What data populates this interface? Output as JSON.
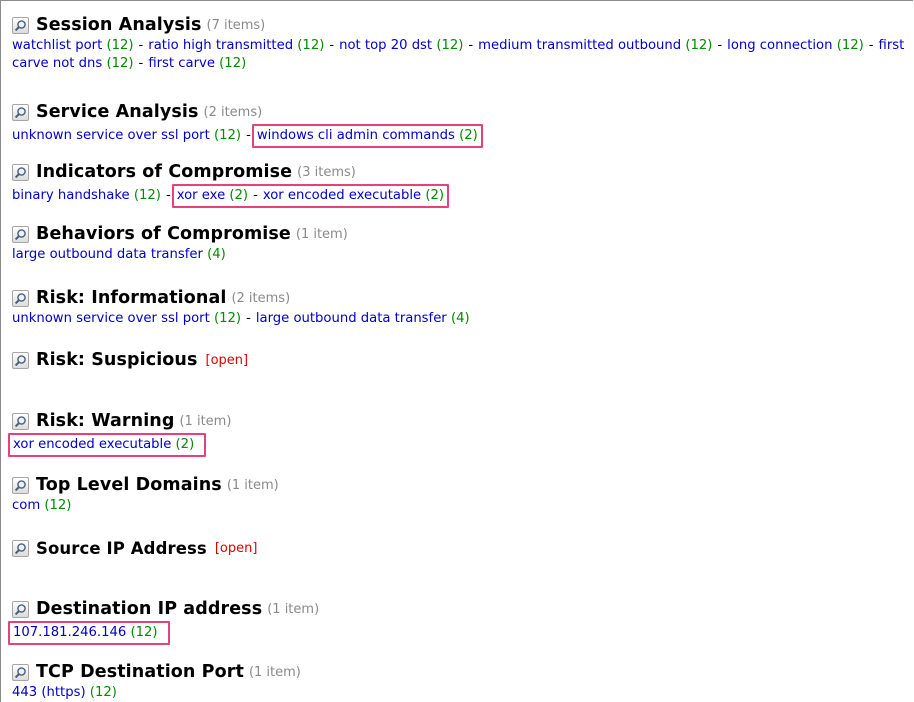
{
  "sections": [
    {
      "title": "Session Analysis",
      "count": "(7 items)",
      "items": [
        {
          "label": "watchlist port",
          "num": "(12)"
        },
        {
          "label": "ratio high transmitted",
          "num": "(12)"
        },
        {
          "label": "not top 20 dst",
          "num": "(12)"
        },
        {
          "label": "medium transmitted outbound",
          "num": "(12)"
        },
        {
          "label": "long connection",
          "num": "(12)"
        },
        {
          "label": "first carve not dns",
          "num": "(12)"
        },
        {
          "label": "first carve",
          "num": "(12)"
        }
      ]
    },
    {
      "title": "Service Analysis",
      "count": "(2 items)",
      "items": [
        {
          "label": "unknown service over ssl port",
          "num": "(12)"
        },
        {
          "label": "windows cli admin commands",
          "num": "(2)"
        }
      ]
    },
    {
      "title": "Indicators of Compromise",
      "count": "(3 items)",
      "items": [
        {
          "label": "binary handshake",
          "num": "(12)"
        },
        {
          "label": "xor exe",
          "num": "(2)"
        },
        {
          "label": "xor encoded executable",
          "num": "(2)"
        }
      ]
    },
    {
      "title": "Behaviors of Compromise",
      "count": "(1 item)",
      "items": [
        {
          "label": "large outbound data transfer",
          "num": "(4)"
        }
      ]
    },
    {
      "title": "Risk: Informational",
      "count": "(2 items)",
      "items": [
        {
          "label": "unknown service over ssl port",
          "num": "(12)"
        },
        {
          "label": "large outbound data transfer",
          "num": "(4)"
        }
      ]
    },
    {
      "title": "Risk: Suspicious",
      "open": "[open]"
    },
    {
      "title": "Risk: Warning",
      "count": "(1 item)",
      "items": [
        {
          "label": "xor encoded executable",
          "num": "(2)"
        }
      ]
    },
    {
      "title": "Top Level Domains",
      "count": "(1 item)",
      "items": [
        {
          "label": "com",
          "num": "(12)"
        }
      ]
    },
    {
      "title": "Source IP Address",
      "open": "[open]"
    },
    {
      "title": "Destination IP address",
      "count": "(1 item)",
      "items": [
        {
          "label": "107.181.246.146",
          "num": "(12)"
        }
      ]
    },
    {
      "title": "TCP Destination Port",
      "count": "(1 item)",
      "items": [
        {
          "label": "443 (https)",
          "num": "(12)"
        }
      ]
    }
  ],
  "separator": "-",
  "icon": "search-icon",
  "colors": {
    "link": "#0000cc",
    "count": "#008a00",
    "open": "#e00000",
    "highlight": "#e8407a"
  }
}
